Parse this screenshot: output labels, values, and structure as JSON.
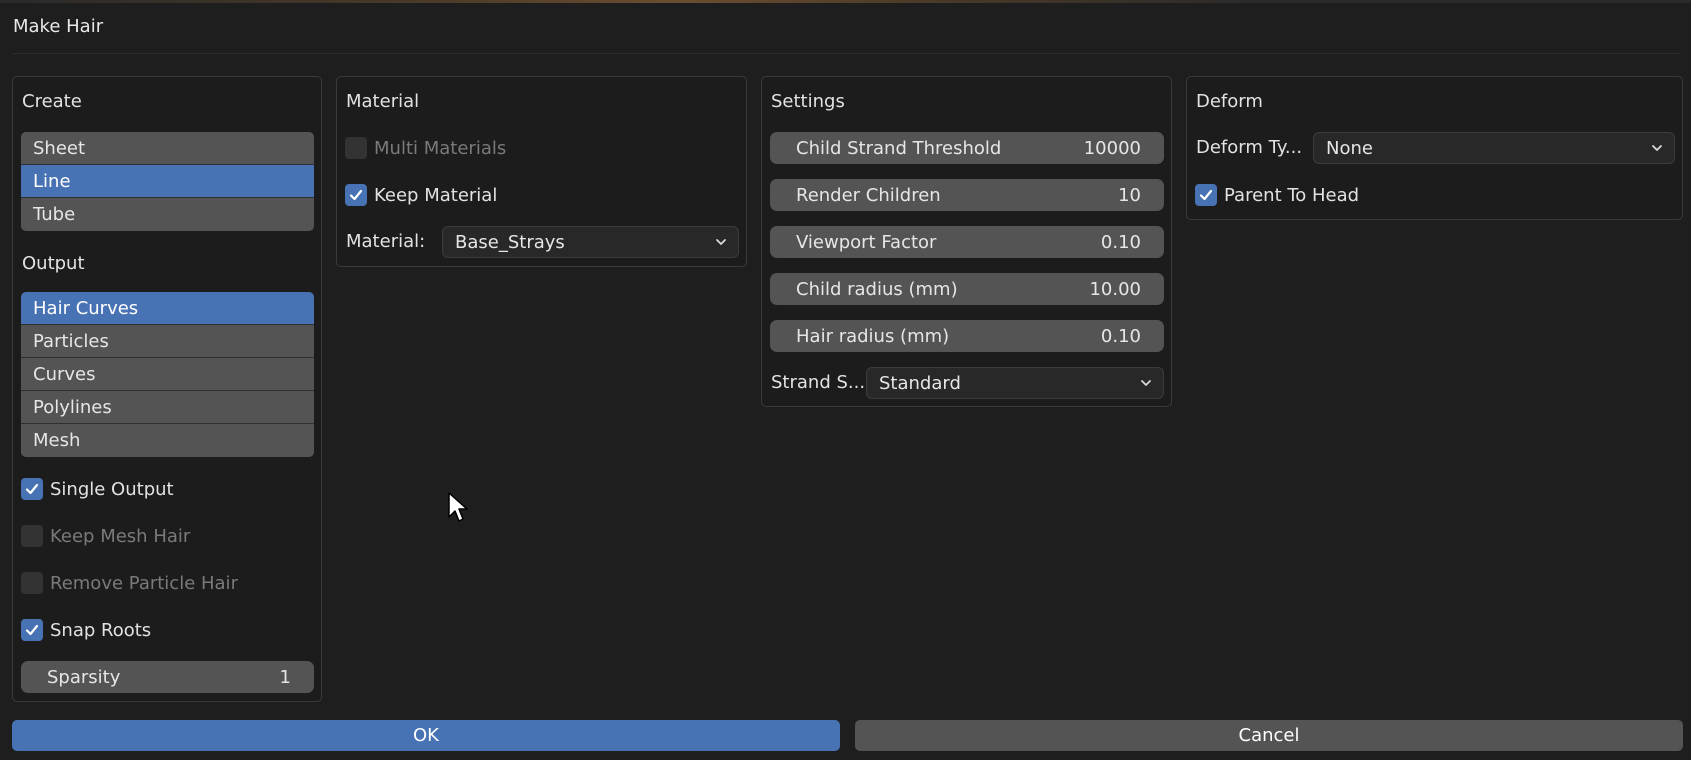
{
  "window": {
    "title": "Make Hair"
  },
  "create_panel": {
    "heading": "Create",
    "create_items": [
      {
        "label": "Sheet",
        "selected": false
      },
      {
        "label": "Line",
        "selected": true
      },
      {
        "label": "Tube",
        "selected": false
      }
    ],
    "output_heading": "Output",
    "output_items": [
      {
        "label": "Hair Curves",
        "selected": true
      },
      {
        "label": "Particles",
        "selected": false
      },
      {
        "label": "Curves",
        "selected": false
      },
      {
        "label": "Polylines",
        "selected": false
      },
      {
        "label": "Mesh",
        "selected": false
      }
    ],
    "single_output": {
      "label": "Single Output",
      "checked": true,
      "enabled": true
    },
    "keep_mesh_hair": {
      "label": "Keep Mesh Hair",
      "checked": false,
      "enabled": false
    },
    "remove_particle_hair": {
      "label": "Remove Particle Hair",
      "checked": false,
      "enabled": false
    },
    "snap_roots": {
      "label": "Snap Roots",
      "checked": true,
      "enabled": true
    },
    "sparsity": {
      "label": "Sparsity",
      "value": "1"
    }
  },
  "material_panel": {
    "heading": "Material",
    "multi_materials": {
      "label": "Multi Materials",
      "checked": false,
      "enabled": false
    },
    "keep_material": {
      "label": "Keep Material",
      "checked": true,
      "enabled": true
    },
    "material_label": "Material:",
    "material_value": "Base_Strays"
  },
  "settings_panel": {
    "heading": "Settings",
    "fields": [
      {
        "label": "Child Strand Threshold",
        "value": "10000"
      },
      {
        "label": "Render Children",
        "value": "10"
      },
      {
        "label": "Viewport Factor",
        "value": "0.10"
      },
      {
        "label": "Child radius (mm)",
        "value": "10.00"
      },
      {
        "label": "Hair radius (mm)",
        "value": "0.10"
      }
    ],
    "strand_label": "Strand S...",
    "strand_value": "Standard"
  },
  "deform_panel": {
    "heading": "Deform",
    "deform_type_label": "Deform Ty...",
    "deform_type_value": "None",
    "parent_to_head": {
      "label": "Parent To Head",
      "checked": true,
      "enabled": true
    }
  },
  "buttons": {
    "ok": "OK",
    "cancel": "Cancel"
  },
  "colors": {
    "accent": "#4772b3",
    "background": "#1e1e1e",
    "panel_border": "#3a3a3a",
    "field": "#545454",
    "button_gray": "#545454"
  },
  "icons": {
    "checkmark": "checkmark-icon",
    "chevron": "chevron-down-icon",
    "cursor": "mouse-pointer-icon"
  }
}
